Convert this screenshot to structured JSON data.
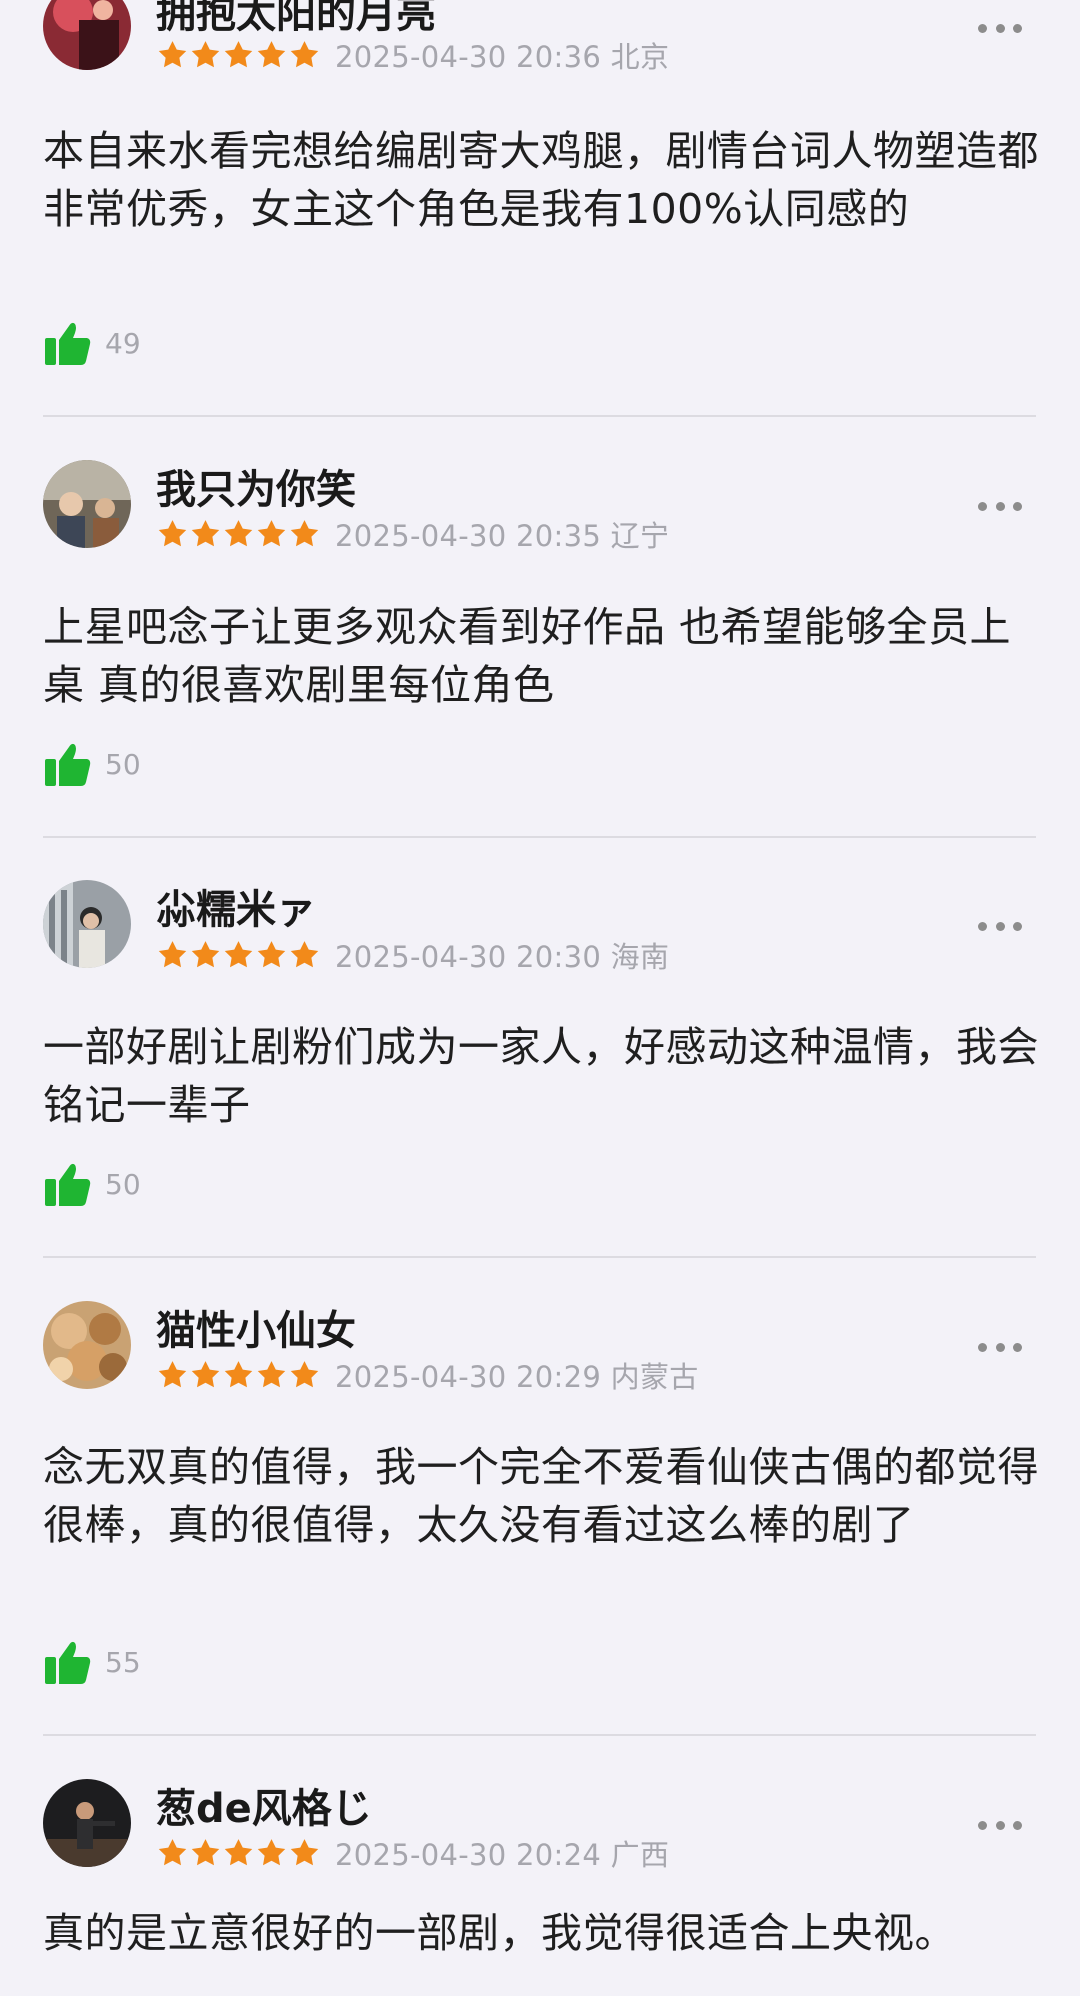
{
  "colors": {
    "background": "#f3f2f8",
    "star": "#f28a1a",
    "like": "#1fb532",
    "meta_text": "#a6a6ad",
    "divider": "#dcdbe1"
  },
  "icons": {
    "rating": "star-icon",
    "like": "thumbs-up-icon",
    "menu": "more-dots-icon"
  },
  "comments": [
    {
      "user": "拥抱太阳的月亮",
      "rating": 5,
      "meta": "2025-04-30 20:36 北京",
      "text": "本自来水看完想给编剧寄大鸡腿，剧情台词人物塑造都非常优秀，女主这个角色是我有100%认同感的",
      "likes": "49"
    },
    {
      "user": "我只为你笑",
      "rating": 5,
      "meta": "2025-04-30 20:35 辽宁",
      "text": "上星吧念子让更多观众看到好作品 也希望能够全员上桌 真的很喜欢剧里每位角色",
      "likes": "50"
    },
    {
      "user": "尛糯米ァ",
      "rating": 5,
      "meta": "2025-04-30 20:30 海南",
      "text": "一部好剧让剧粉们成为一家人，好感动这种温情，我会铭记一辈子",
      "likes": "50"
    },
    {
      "user": "猫性小仙女",
      "rating": 5,
      "meta": "2025-04-30 20:29 内蒙古",
      "text": "念无双真的值得，我一个完全不爱看仙侠古偶的都觉得很棒，真的很值得，太久没有看过这么棒的剧了",
      "likes": "55"
    },
    {
      "user": "葱de风格じ",
      "rating": 5,
      "meta": "2025-04-30 20:24 广西",
      "text": "真的是立意很好的一部剧，我觉得很适合上央视。",
      "likes": ""
    }
  ]
}
